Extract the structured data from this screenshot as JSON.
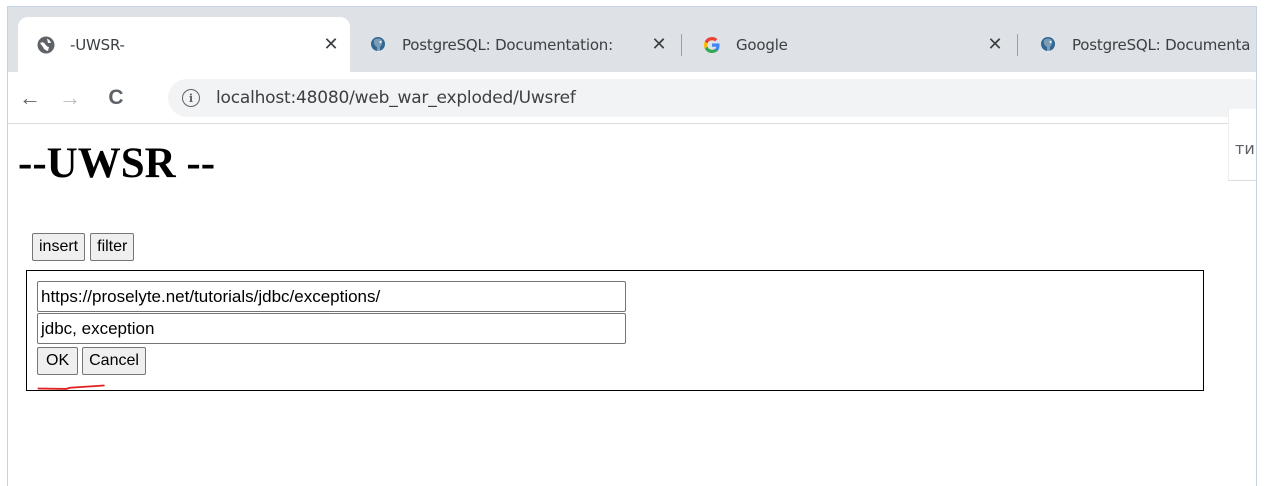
{
  "tabs": [
    {
      "title": "-UWSR-",
      "favicon": "globe-icon",
      "active": true
    },
    {
      "title": "PostgreSQL: Documentation:",
      "favicon": "postgresql-elephant-icon",
      "active": false
    },
    {
      "title": "Google",
      "favicon": "google-g-icon",
      "active": false
    },
    {
      "title": "PostgreSQL: Documenta",
      "favicon": "postgresql-elephant-icon",
      "active": false
    }
  ],
  "toolbar": {
    "url": "localhost:48080/web_war_exploded/Uwsref",
    "back_icon": "←",
    "forward_icon": "→",
    "reload_icon": "C",
    "info_icon": "i"
  },
  "side_panel": {
    "text": "ти"
  },
  "page": {
    "title": "--UWSR --",
    "insert_label": "insert",
    "filter_label": "filter",
    "form": {
      "url_value": "https://proselyte.net/tutorials/jdbc/exceptions/",
      "tags_value": "jdbc, exception",
      "ok_label": "OK",
      "cancel_label": "Cancel"
    }
  },
  "colors": {
    "tabstrip": "#dee1e6",
    "omnibox": "#f1f3f4",
    "annotation_underline": "#e02020"
  }
}
